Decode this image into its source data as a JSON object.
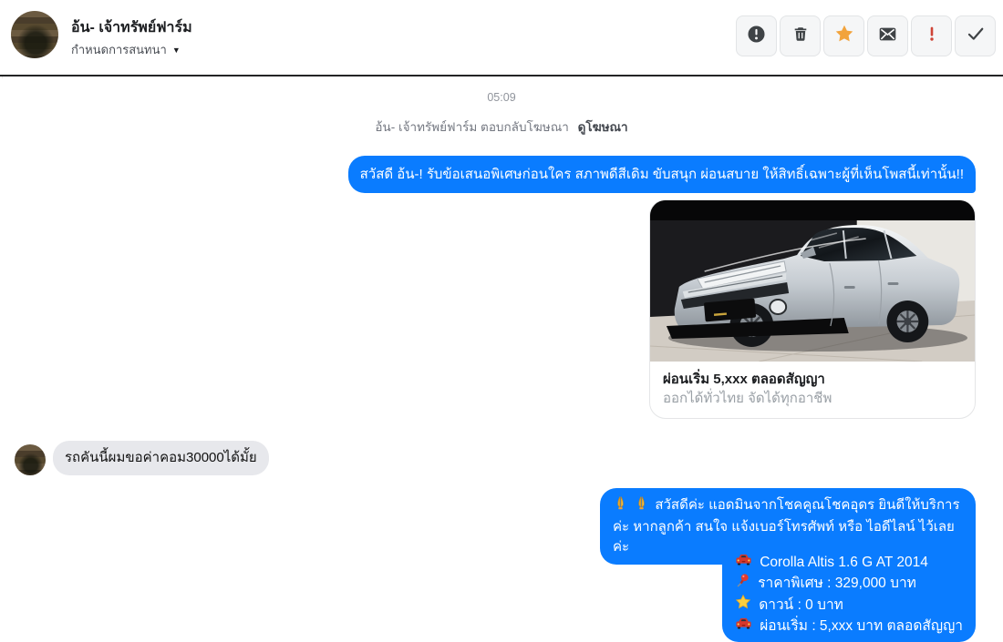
{
  "colors": {
    "accent_blue": "#0a7cff",
    "bubble_gray": "#e7e8ec",
    "star_orange": "#f2a33c",
    "danger_red": "#cf4436",
    "icon_dark": "#3f4346",
    "header_border": "#232425"
  },
  "header": {
    "name": "อ้น- เจ้าทรัพย์ฟาร์ม",
    "subtitle": "กำหนดการสนทนา",
    "toolbar": [
      {
        "name": "report-spam"
      },
      {
        "name": "delete"
      },
      {
        "name": "star"
      },
      {
        "name": "mark-unread"
      },
      {
        "name": "mark-important"
      },
      {
        "name": "mark-done"
      }
    ]
  },
  "conversation": {
    "timestamp": "05:09",
    "context_line": {
      "text": "อ้น- เจ้าทรัพย์ฟาร์ม ตอบกลับโฆษณา",
      "link": "ดูโฆษณา"
    },
    "messages": [
      {
        "type": "outgoing_text",
        "text": "สวัสดี อ้น-! รับข้อเสนอพิเศษก่อนใคร สภาพดีสีเดิม ขับสนุก ผ่อนสบาย ให้สิทธิ์เฉพาะผู้ที่เห็นโพสนี้เท่านั้น!!"
      },
      {
        "type": "outgoing_card",
        "image": "silver-sedan-showroom-photo",
        "title": "ผ่อนเริ่ม 5,xxx ตลอดสัญญา",
        "subtitle": "ออกได้ทั่วไทย จัดได้ทุกอาชีพ"
      },
      {
        "type": "incoming_text",
        "text": "รถคันนี้ผมขอค่าคอม30000ได้มั้ย"
      },
      {
        "type": "outgoing_text",
        "icons": [
          "praying-hands",
          "praying-hands"
        ],
        "text": "สวัสดีค่ะ แอดมินจากโชคคูณโชคอุดร ยินดีให้บริการค่ะ หากลูกค้า สนใจ แจ้งเบอร์โทรศัพท์ หรือ ไอดีไลน์  ไว้เลยค่ะ"
      },
      {
        "type": "outgoing_spec_list",
        "lines": [
          {
            "icon": "car",
            "text": "Corolla Altis 1.6 G  AT 2014"
          },
          {
            "icon": "pushpin",
            "text": "ราคาพิเศษ : 329,000 บาท"
          },
          {
            "icon": "star",
            "text": "ดาวน์ : 0 บาท"
          },
          {
            "icon": "car",
            "text": "ผ่อนเริ่ม : 5,xxx บาท ตลอดสัญญา"
          }
        ]
      }
    ]
  }
}
